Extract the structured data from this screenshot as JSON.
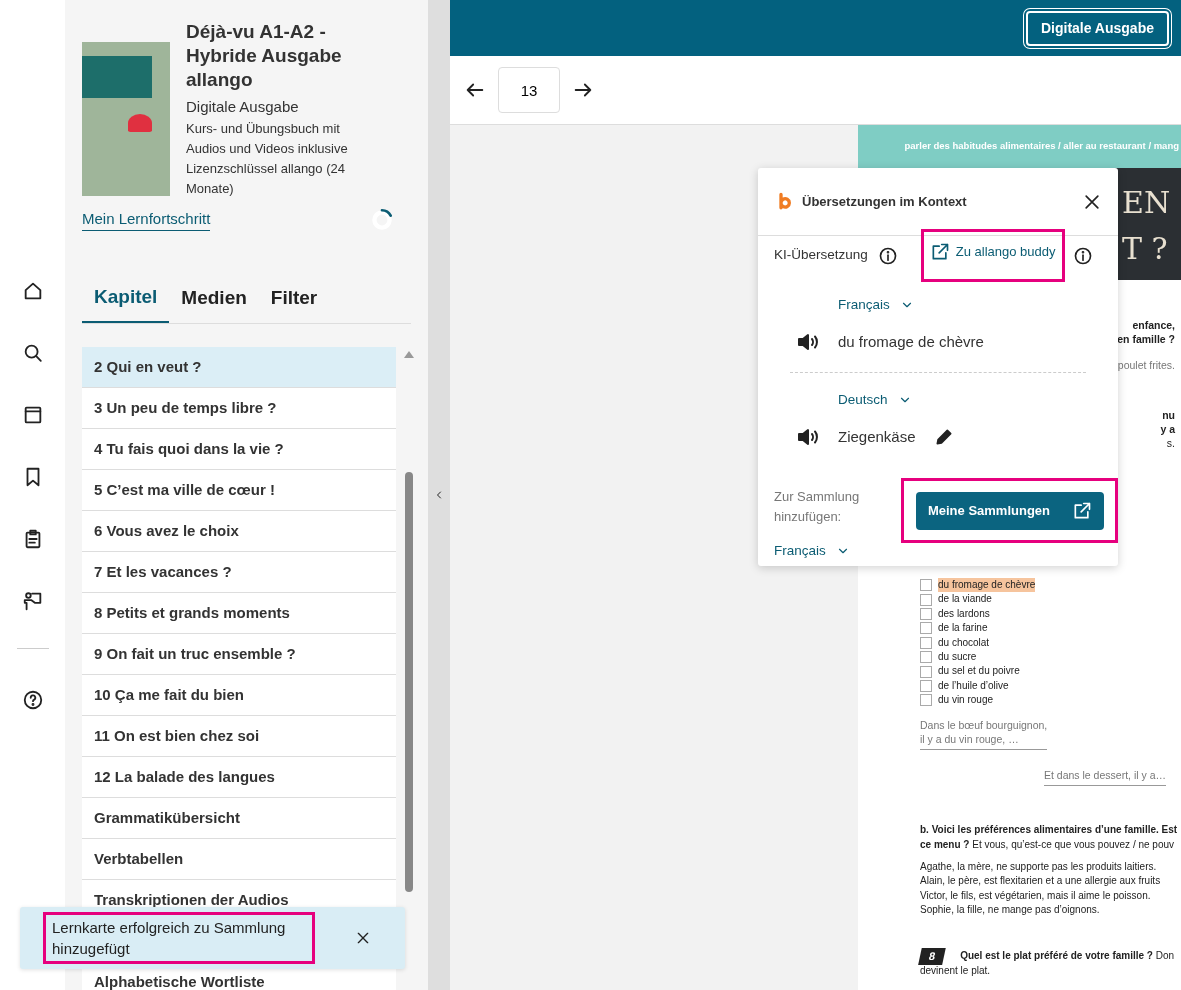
{
  "top_bar": {
    "edition_button": "Digitale Ausgabe"
  },
  "pager": {
    "page": "13"
  },
  "book": {
    "title": "Déjà-vu A1-A2 - Hybride Ausgabe allango",
    "edition": "Digitale Ausgabe",
    "description": "Kurs- und Übungsbuch mit Audios und Videos inklusive Lizenzschlüssel allango (24 Monate)",
    "progress_link": "Mein Lernfortschritt"
  },
  "tabs": [
    {
      "label": "Kapitel",
      "selected": true
    },
    {
      "label": "Medien",
      "selected": false
    },
    {
      "label": "Filter",
      "selected": false
    }
  ],
  "chapters": [
    {
      "label": "2 Qui en veut ?",
      "selected": true
    },
    {
      "label": "3 Un peu de temps libre ?",
      "selected": false
    },
    {
      "label": "4 Tu fais quoi dans la vie ?",
      "selected": false
    },
    {
      "label": "5 C’est ma ville de cœur !",
      "selected": false
    },
    {
      "label": "6 Vous avez le choix",
      "selected": false
    },
    {
      "label": "7 Et les vacances ?",
      "selected": false
    },
    {
      "label": "8 Petits et grands moments",
      "selected": false
    },
    {
      "label": "9 On fait un truc ensemble ?",
      "selected": false
    },
    {
      "label": "10 Ça me fait du bien",
      "selected": false
    },
    {
      "label": "11 On est bien chez soi",
      "selected": false
    },
    {
      "label": "12 La balade des langues",
      "selected": false
    },
    {
      "label": "Grammatikübersicht",
      "selected": false
    },
    {
      "label": "Verbtabellen",
      "selected": false
    },
    {
      "label": "Transkriptionen der Audios",
      "selected": false
    },
    {
      "label": "Alphabetische Wortliste",
      "selected": false
    }
  ],
  "toast": {
    "message": "Lernkarte erfolgreich zu Sammlung hinzugefügt"
  },
  "translation_popup": {
    "title": "Übersetzungen im Kontext",
    "ai_label": "KI-Übersetzung",
    "buddy_link": "Zu allango buddy",
    "source": {
      "language": "Français",
      "text": "du fromage de chèvre"
    },
    "target": {
      "language": "Deutsch",
      "text": "Ziegenkäse"
    },
    "collection_label": "Zur Sammlung hinzufügen:",
    "collection_language": "Français",
    "collections_button": "Meine Sammlungen"
  },
  "book_page": {
    "header": "parler des habitudes alimentaires / aller au restaurant / mang",
    "title_lines": [
      "EN",
      "T ?"
    ],
    "fragments": [
      {
        "text": "enfance,",
        "bold": true
      },
      {
        "text": "en famille ?",
        "bold": true
      },
      {
        "text": "poulet frites.",
        "bold": false
      },
      {
        "text": "nu",
        "bold": true
      },
      {
        "text": "y a",
        "bold": true
      },
      {
        "text": "s.",
        "bold": false
      }
    ],
    "checklist": [
      {
        "label": "du fromage de chèvre",
        "checked": false,
        "highlighted": true
      },
      {
        "label": "de la viande",
        "checked": false,
        "highlighted": false
      },
      {
        "label": "des lardons",
        "checked": false,
        "highlighted": false
      },
      {
        "label": "de la farine",
        "checked": false,
        "highlighted": false
      },
      {
        "label": "du chocolat",
        "checked": false,
        "highlighted": false
      },
      {
        "label": "du sucre",
        "checked": false,
        "highlighted": false
      },
      {
        "label": "du sel et du poivre",
        "checked": false,
        "highlighted": false
      },
      {
        "label": "de l’huile d’olive",
        "checked": false,
        "highlighted": false
      },
      {
        "label": "du vin rouge",
        "checked": false,
        "highlighted": false
      }
    ],
    "bubbles": [
      {
        "lines": [
          "Dans le bœuf bourguignon,",
          "il y a du vin rouge, …"
        ]
      },
      {
        "lines": [
          "Et dans le dessert, il y a…"
        ]
      }
    ],
    "task_b": [
      "**b. Voici les préférences alimentaires d’une famille. Est**",
      "**ce menu ?** Et vous, qu’est-ce que vous pouvez / ne pouv"
    ],
    "family_lines": [
      "Agathe, la mère, ne supporte pas les produits laitiers.",
      "Alain, le père, est flexitarien et a une allergie aux fruits",
      "Victor, le fils, est végétarien, mais il aime le poisson.",
      "Sophie, la fille, ne mange pas d’oignons."
    ],
    "exercise": {
      "number": "8",
      "lines": [
        "**Quel est le plat préféré de votre famille ?** Don",
        "devinent le plat."
      ]
    }
  }
}
